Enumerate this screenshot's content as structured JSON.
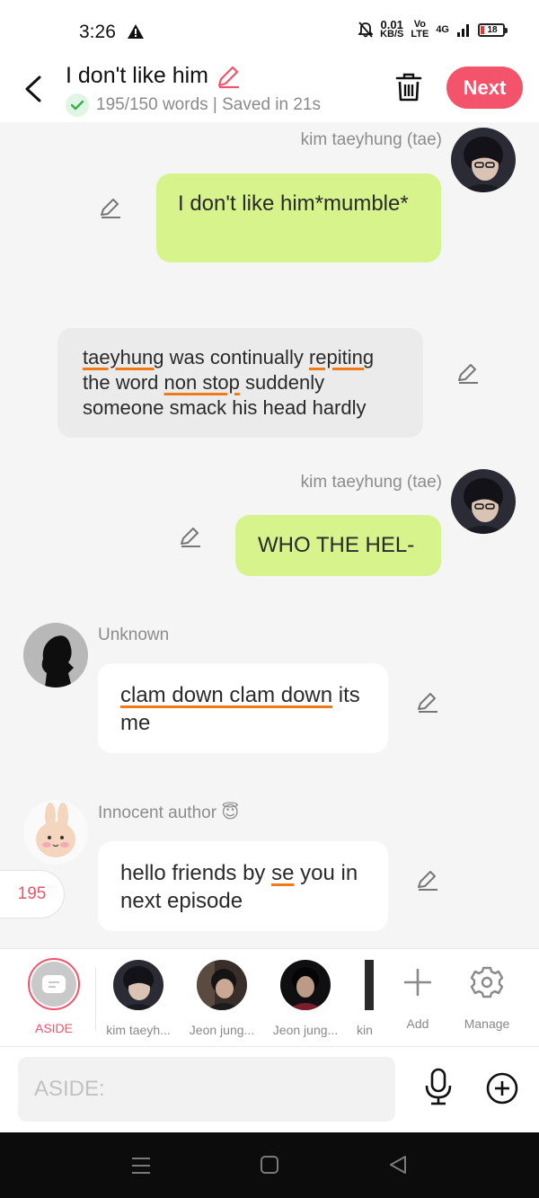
{
  "status_bar": {
    "time": "3:26",
    "net_speed_value": "0.01",
    "net_speed_unit": "KB/S",
    "volte": "Vo",
    "lte": "LTE",
    "network": "4G",
    "battery": "18"
  },
  "header": {
    "title": "I don't like him",
    "subtitle": "195/150 words | Saved in 21s",
    "next_label": "Next"
  },
  "messages": [
    {
      "speaker": "kim taeyhung (tae)",
      "text": "I don't like him*mumble*"
    },
    {
      "speaker": "",
      "segments": [
        {
          "text": "taeyhung",
          "underline": true
        },
        {
          "text": " was continually ",
          "underline": false
        },
        {
          "text": "repiting",
          "underline": true
        },
        {
          "text": " the word ",
          "underline": false
        },
        {
          "text": "non stop",
          "underline": true
        },
        {
          "text": " suddenly someone smack his head hardly",
          "underline": false
        }
      ]
    },
    {
      "speaker": "kim taeyhung (tae)",
      "text": "WHO THE HEL-"
    },
    {
      "speaker": "Unknown",
      "segments": [
        {
          "text": "clam down clam down",
          "underline": true
        },
        {
          "text": " its me",
          "underline": false
        }
      ]
    },
    {
      "speaker": "Innocent author 😇",
      "segments": [
        {
          "text": "hello friends by ",
          "underline": false
        },
        {
          "text": "se",
          "underline": true
        },
        {
          "text": " you in next episode",
          "underline": false
        }
      ]
    }
  ],
  "word_count_badge": "195",
  "characters": [
    {
      "label": "ASIDE"
    },
    {
      "label": "kim taeyh..."
    },
    {
      "label": "Jeon jung..."
    },
    {
      "label": "Jeon jung..."
    },
    {
      "label": "kin"
    }
  ],
  "actions": {
    "add_label": "Add",
    "manage_label": "Manage"
  },
  "input": {
    "placeholder": "ASIDE:"
  },
  "colors": {
    "accent": "#f3536b",
    "speaker_bubble": "#d6f38c",
    "underline": "#f07a18"
  }
}
